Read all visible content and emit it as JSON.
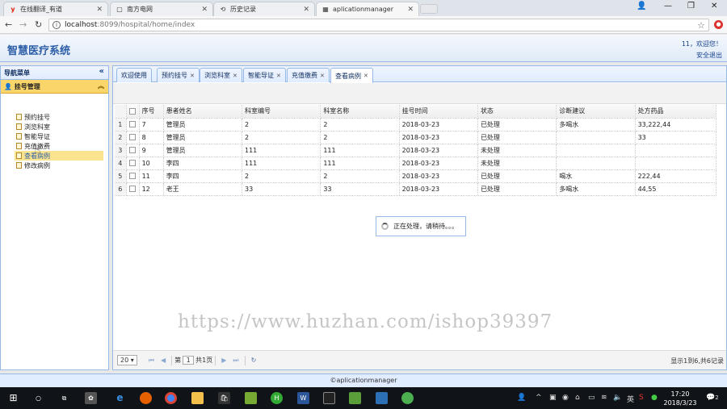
{
  "browser": {
    "tabs": [
      {
        "label": "在线翻译_有道",
        "favicon": "y",
        "active": false
      },
      {
        "label": "南方电网",
        "favicon": "▢",
        "active": false
      },
      {
        "label": "历史记录",
        "favicon": "⟲",
        "active": false
      },
      {
        "label": "aplicationmanager",
        "favicon": "▦",
        "active": true
      }
    ],
    "address": {
      "host": "localhost",
      "path": ":8099/hospital/home/index"
    }
  },
  "header": {
    "title": "智慧医疗系统",
    "welcome": "11，欢迎您！",
    "logout": "安全退出"
  },
  "nav": {
    "title": "导航菜单",
    "group": "挂号管理",
    "items": [
      "预约挂号",
      "浏览科室",
      "智能导证",
      "充值缴费",
      "查看病例",
      "修改病例"
    ],
    "selected_index": 4
  },
  "page_tabs": [
    {
      "label": "欢迎使用",
      "closable": false
    },
    {
      "label": "预约挂号",
      "closable": true
    },
    {
      "label": "浏览科室",
      "closable": true
    },
    {
      "label": "智能导证",
      "closable": true
    },
    {
      "label": "充值缴费",
      "closable": true
    },
    {
      "label": "查看病例",
      "closable": true,
      "active": true
    }
  ],
  "table": {
    "columns": [
      "序号",
      "患者姓名",
      "科室编号",
      "科室名称",
      "挂号时间",
      "状态",
      "诊断建议",
      "处方药品"
    ],
    "rows": [
      [
        "1",
        "7",
        "管理员",
        "2",
        "2",
        "2018-03-23",
        "已处理",
        "多喝水",
        "33,222,44"
      ],
      [
        "2",
        "8",
        "管理员",
        "2",
        "2",
        "2018-03-23",
        "已处理",
        "",
        "33"
      ],
      [
        "3",
        "9",
        "管理员",
        "111",
        "111",
        "2018-03-23",
        "未处理",
        "",
        ""
      ],
      [
        "4",
        "10",
        "李四",
        "111",
        "111",
        "2018-03-23",
        "未处理",
        "",
        ""
      ],
      [
        "5",
        "11",
        "李四",
        "2",
        "2",
        "2018-03-23",
        "已处理",
        "喝水",
        "222,44"
      ],
      [
        "6",
        "12",
        "老王",
        "33",
        "33",
        "2018-03-23",
        "已处理",
        "多喝水",
        "44,55"
      ]
    ]
  },
  "loading_text": "正在处理，请稍待。。。",
  "watermark": "https://www.huzhan.com/ishop39397",
  "pager": {
    "page_size": "20",
    "page_prefix": "第",
    "page_value": "1",
    "page_total": "共1页",
    "info": "显示1到6,共6记录"
  },
  "footer": "©aplicationmanager",
  "taskbar": {
    "time": "17:20",
    "date": "2018/3/23",
    "ime": "英",
    "notifications": "2"
  }
}
